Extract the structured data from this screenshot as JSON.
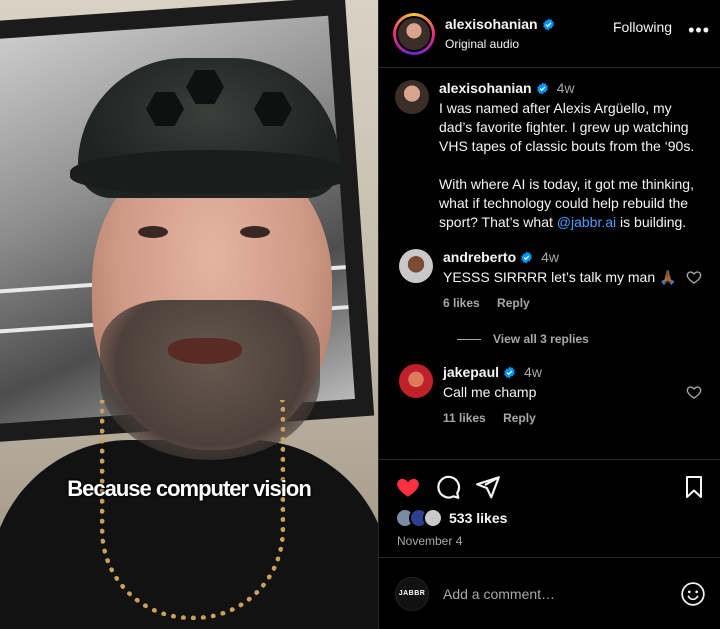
{
  "video": {
    "caption": "Because computer vision"
  },
  "header": {
    "username": "alexisohanian",
    "subtitle": "Original audio",
    "follow_label": "Following",
    "more_label": "•••"
  },
  "post": {
    "username": "alexisohanian",
    "time": "4w",
    "paragraph1": "I was named after Alexis Argüello, my dad’s favorite fighter. I grew up watching VHS tapes of classic bouts from the ‘90s.",
    "paragraph2_pre": "With where AI is today, it got me thinking, what if technology could help rebuild the sport? That’s what ",
    "mention": "@jabbr.ai",
    "paragraph2_post": " is building."
  },
  "comments": [
    {
      "username": "andreberto",
      "time": "4w",
      "text": "YESSS SIRRRR let’s talk my man 🙏🏾",
      "likes": "6 likes",
      "reply": "Reply",
      "view_replies": "View all 3 replies"
    },
    {
      "username": "jakepaul",
      "time": "4w",
      "text": "Call me champ",
      "likes": "11 likes",
      "reply": "Reply"
    }
  ],
  "engagement": {
    "likes": "533 likes",
    "date": "November 4",
    "liked": true,
    "like_color": "#ff3040"
  },
  "composer": {
    "brand": "JABBR",
    "placeholder": "Add a comment…"
  },
  "colors": {
    "verified": "#0095f6",
    "mention": "#4a9eff",
    "muted": "#a8a8a8"
  }
}
